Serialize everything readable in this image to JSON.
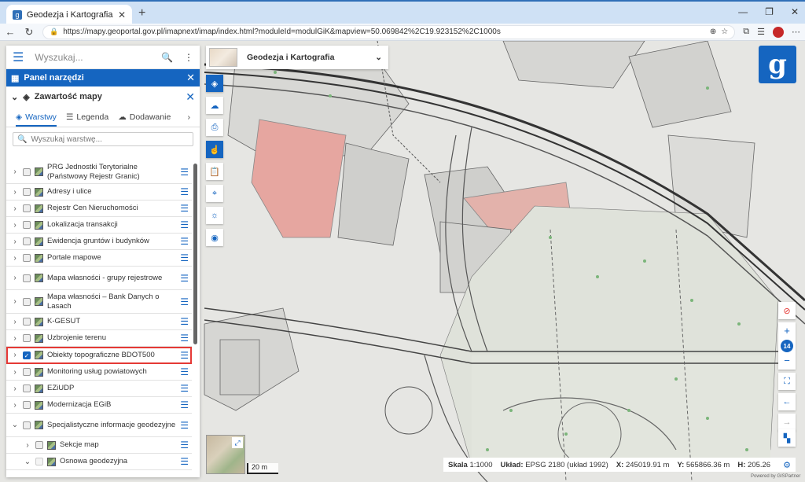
{
  "browser": {
    "tab_title": "Geodezja i Kartografia - Geoportal",
    "new_tab": "+",
    "url": "https://mapy.geoportal.gov.pl/imapnext/imap/index.html?moduleId=modulGiK&mapview=50.069842%2C19.923152%2C1000s"
  },
  "search": {
    "placeholder": "Wyszukaj..."
  },
  "panel": {
    "title": "Panel narzędzi",
    "contents_title": "Zawartość mapy",
    "tabs": [
      "Warstwy",
      "Legenda",
      "Dodawanie"
    ],
    "layer_search_placeholder": "Wyszukaj warstwę..."
  },
  "layers": [
    {
      "label": "PRG Jednostki Terytorialne (Państwowy Rejestr Granic)",
      "checked": false
    },
    {
      "label": "Adresy i ulice",
      "checked": false
    },
    {
      "label": "Rejestr Cen Nieruchomości",
      "checked": false
    },
    {
      "label": "Lokalizacja transakcji",
      "checked": false
    },
    {
      "label": "Ewidencja gruntów i budynków",
      "checked": false
    },
    {
      "label": "Portale mapowe",
      "checked": false
    },
    {
      "label": "Mapa własności - grupy rejestrowe",
      "checked": false
    },
    {
      "label": "Mapa własności – Bank Danych o Lasach",
      "checked": false
    },
    {
      "label": "K-GESUT",
      "checked": false
    },
    {
      "label": "Uzbrojenie terenu",
      "checked": false
    },
    {
      "label": "Obiekty topograficzne BDOT500",
      "checked": true
    },
    {
      "label": "Monitoring usług powiatowych",
      "checked": false
    },
    {
      "label": "EZiUDP",
      "checked": false
    },
    {
      "label": "Modernizacja EGiB",
      "checked": false
    },
    {
      "label": "Specjalistyczne informacje geodezyjne",
      "checked": false
    },
    {
      "label": "Sekcje map",
      "checked": false
    },
    {
      "label": "Osnowa geodezyjna",
      "checked": false
    }
  ],
  "module_dropdown": {
    "label": "Geodezja i Kartografia"
  },
  "map": {
    "zoom_level": "14",
    "scale_bar": "20 m"
  },
  "status_bar": {
    "scale_label": "Skala",
    "scale_value": "1:1000",
    "crs_label": "Układ:",
    "crs_value": "EPSG 2180 (układ 1992)",
    "x_label": "X:",
    "x_value": "245019.91 m",
    "y_label": "Y:",
    "y_value": "565866.36 m",
    "h_label": "H:",
    "h_value": "205.26"
  },
  "powered_by": "Powered by GISPartner",
  "colors": {
    "accent": "#1565c0",
    "highlight": "#e53935"
  }
}
